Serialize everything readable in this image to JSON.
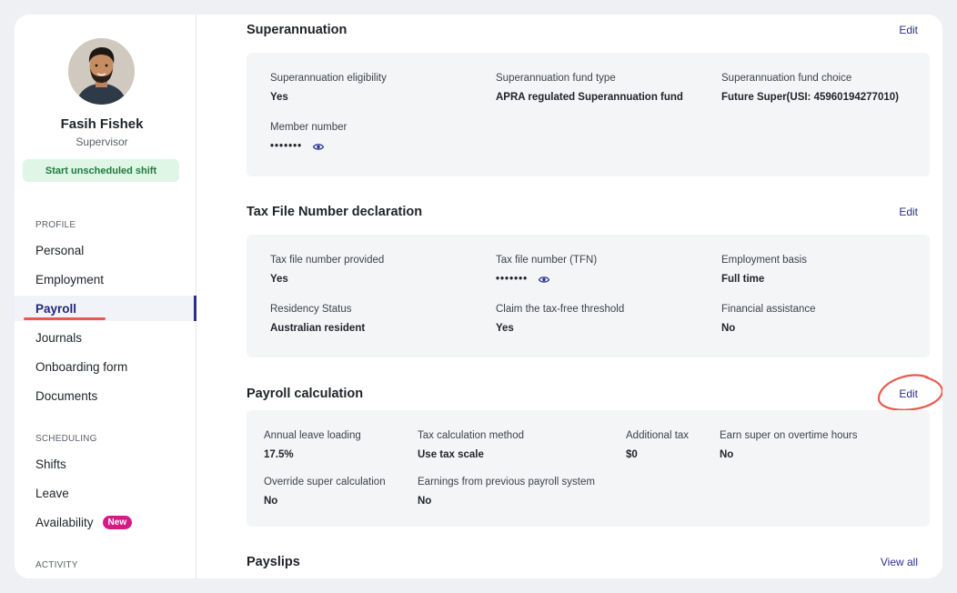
{
  "profile": {
    "name": "Fasih Fishek",
    "role": "Supervisor",
    "shift_button": "Start unscheduled shift"
  },
  "sidebar": {
    "sections": [
      {
        "label": "PROFILE",
        "items": [
          {
            "label": "Personal"
          },
          {
            "label": "Employment"
          },
          {
            "label": "Payroll",
            "active": true
          },
          {
            "label": "Journals"
          },
          {
            "label": "Onboarding form"
          },
          {
            "label": "Documents"
          }
        ]
      },
      {
        "label": "SCHEDULING",
        "items": [
          {
            "label": "Shifts"
          },
          {
            "label": "Leave"
          },
          {
            "label": "Availability",
            "badge": "New"
          }
        ]
      },
      {
        "label": "ACTIVITY",
        "items": []
      }
    ]
  },
  "superannuation": {
    "title": "Superannuation",
    "action": "Edit",
    "fields": [
      {
        "label": "Superannuation eligibility",
        "value": "Yes"
      },
      {
        "label": "Superannuation fund type",
        "value": "APRA regulated Superannuation fund"
      },
      {
        "label": "Superannuation fund choice",
        "value": "Future Super(USI: 45960194277010)"
      },
      {
        "label": "Member number",
        "value": "•••••••"
      }
    ]
  },
  "tfn": {
    "title": "Tax File Number declaration",
    "action": "Edit",
    "fields": [
      {
        "label": "Tax file number provided",
        "value": "Yes"
      },
      {
        "label": "Tax file number (TFN)",
        "value": "•••••••"
      },
      {
        "label": "Employment basis",
        "value": "Full time"
      },
      {
        "label": "Residency Status",
        "value": "Australian resident"
      },
      {
        "label": "Claim the tax-free threshold",
        "value": "Yes"
      },
      {
        "label": "Financial assistance",
        "value": "No"
      }
    ]
  },
  "payroll_calc": {
    "title": "Payroll calculation",
    "action": "Edit",
    "fields": [
      {
        "label": "Annual leave loading",
        "value": "17.5%"
      },
      {
        "label": "Tax calculation method",
        "value": "Use tax scale"
      },
      {
        "label": "Additional tax",
        "value": "$0"
      },
      {
        "label": "Earn super on overtime hours",
        "value": "No"
      },
      {
        "label": "Override super calculation",
        "value": "No"
      },
      {
        "label": "Earnings from previous payroll system",
        "value": "No"
      }
    ]
  },
  "payslips": {
    "title": "Payslips",
    "action": "View all"
  },
  "colors": {
    "accent": "#2a2f8c",
    "badge": "#d31b86",
    "annotation": "#e85a4f",
    "shift_button_bg": "#dff5e6"
  }
}
